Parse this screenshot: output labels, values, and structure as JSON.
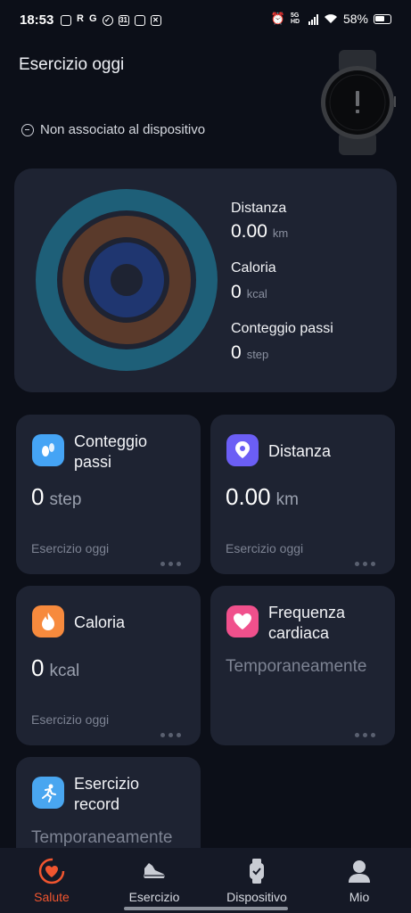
{
  "status": {
    "time": "18:53",
    "left_icons": [
      "instagram-icon",
      "r-icon",
      "g-icon",
      "check-icon",
      "calendar-icon",
      "briefcase-icon",
      "mail-icon"
    ],
    "network": "5G HD",
    "battery": "58%"
  },
  "header": {
    "title": "Esercizio oggi",
    "device_status": "Non associato al dispositivo"
  },
  "summary": {
    "distance_label": "Distanza",
    "distance_value": "0.00",
    "distance_unit": "km",
    "calorie_label": "Caloria",
    "calorie_value": "0",
    "calorie_unit": "kcal",
    "steps_label": "Conteggio passi",
    "steps_value": "0",
    "steps_unit": "step",
    "ring_colors": [
      "#1e5f78",
      "#5a3a2b",
      "#1f3670"
    ]
  },
  "tiles": {
    "steps": {
      "title_line1": "Conteggio",
      "title_line2": "passi",
      "value": "0",
      "unit": "step",
      "sub": "Esercizio oggi",
      "icon_color": "#45a4f5"
    },
    "distance": {
      "title": "Distanza",
      "value": "0.00",
      "unit": "km",
      "sub": "Esercizio oggi",
      "icon_color": "#6b5ef5"
    },
    "calorie": {
      "title": "Caloria",
      "value": "0",
      "unit": "kcal",
      "sub": "Esercizio oggi",
      "icon_color": "#f78a3d"
    },
    "heart": {
      "title_line1": "Frequenza",
      "title_line2": "cardiaca",
      "status": "Temporaneamente",
      "icon_color": "#f0508c"
    },
    "record": {
      "title_line1": "Esercizio",
      "title_line2": "record",
      "status": "Temporaneamente",
      "icon_color": "#49a6f0"
    }
  },
  "nav": {
    "health": "Salute",
    "exercise": "Esercizio",
    "device": "Dispositivo",
    "me": "Mio",
    "active_color": "#f0552f"
  }
}
